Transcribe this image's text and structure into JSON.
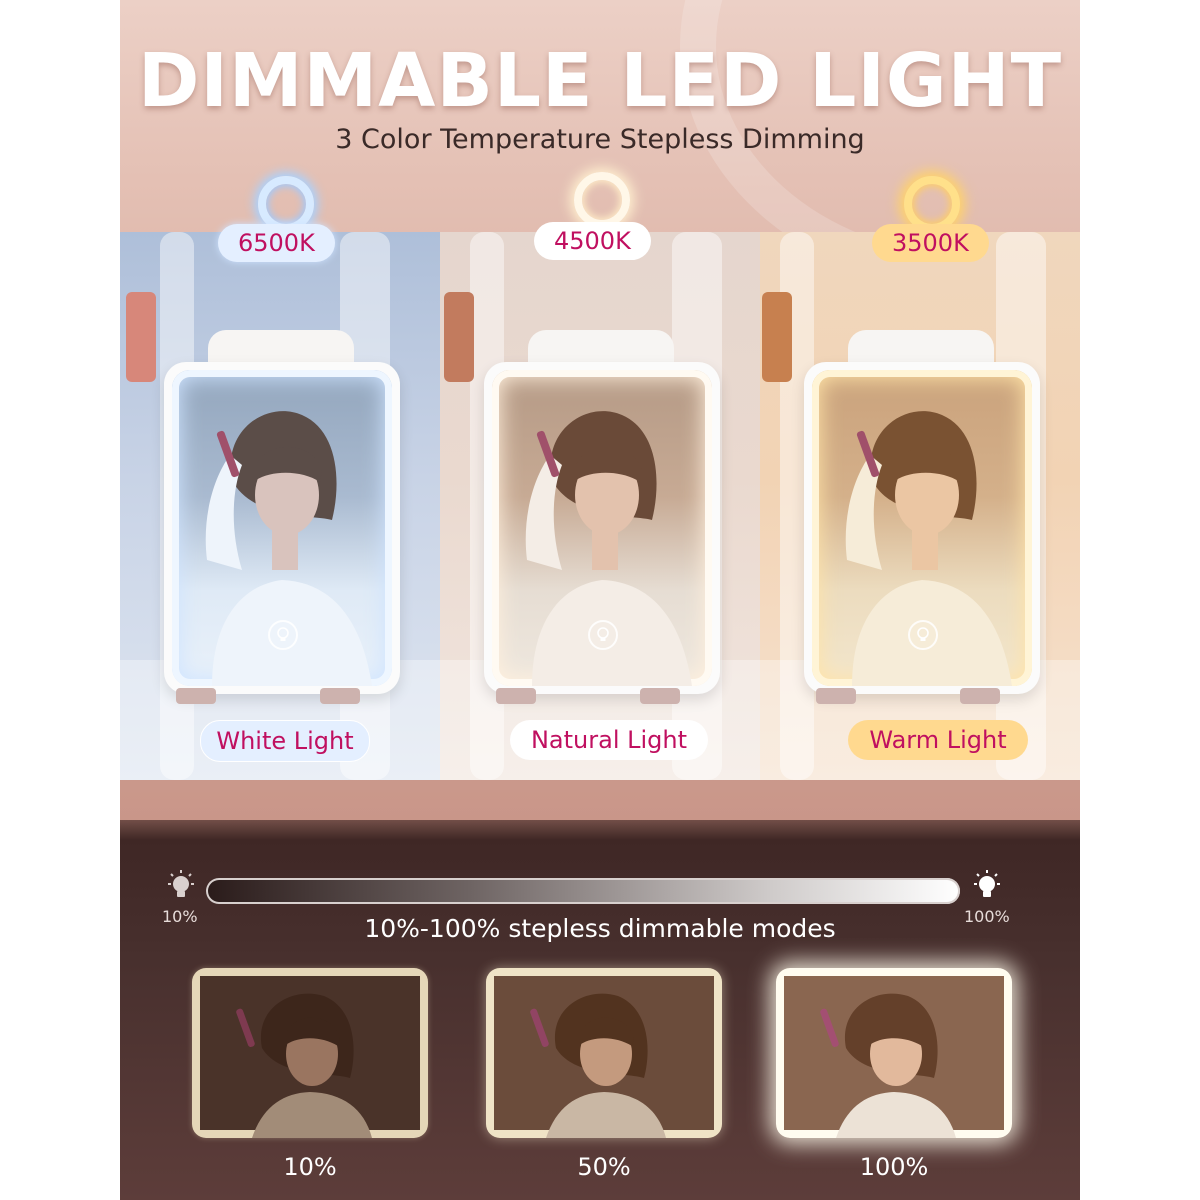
{
  "headline": "DIMMABLE LED LIGHT",
  "subheadline": "3 Color Temperature Stepless Dimming",
  "color_modes": [
    {
      "kelvin": "6500K",
      "mode": "White Light",
      "color": "#e4efff"
    },
    {
      "kelvin": "4500K",
      "mode": "Natural Light",
      "color": "#ffffff"
    },
    {
      "kelvin": "3500K",
      "mode": "Warm Light",
      "color": "#ffd98f"
    }
  ],
  "accent_text_color": "#c01060",
  "dimmer": {
    "min_label": "10%",
    "max_label": "100%",
    "caption": "10%-100% stepless dimmable modes",
    "min_icon": "lightbulb-dim-icon",
    "max_icon": "lightbulb-bright-icon"
  },
  "brightness_levels": [
    {
      "label": "10%",
      "level": 0.1
    },
    {
      "label": "50%",
      "level": 0.5
    },
    {
      "label": "100%",
      "level": 1.0
    }
  ],
  "mirror_touch_icon": "lightbulb-touch-icon"
}
